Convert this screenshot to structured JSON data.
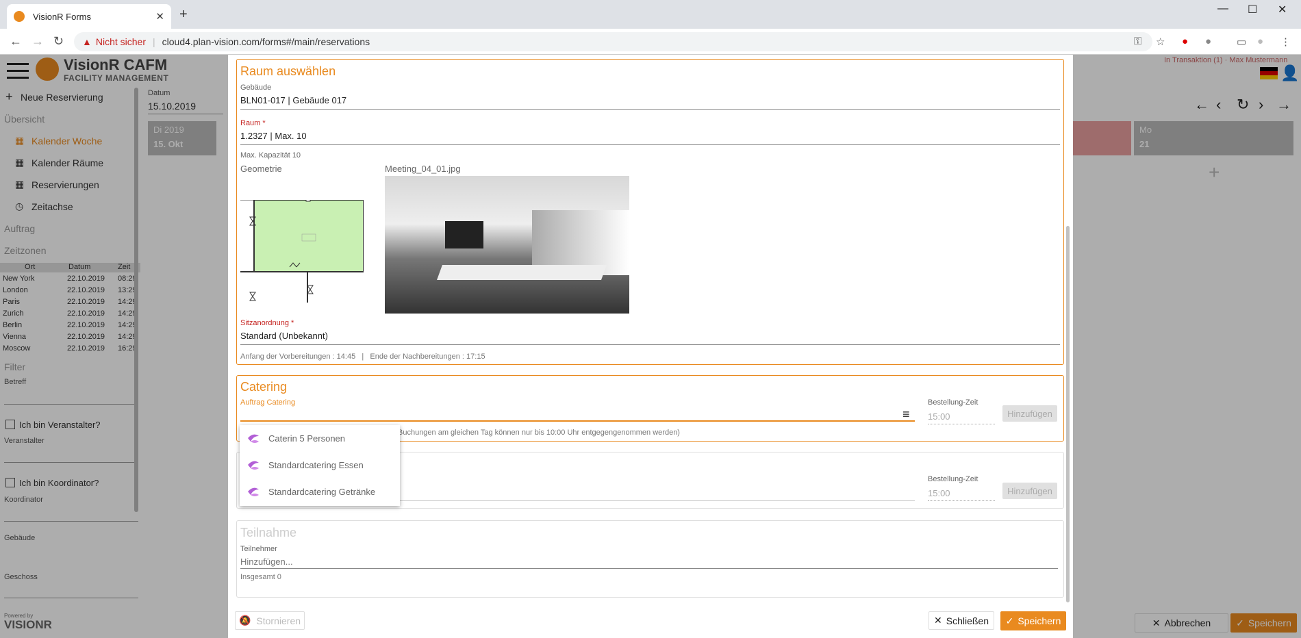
{
  "browser": {
    "tab_title": "VisionR Forms",
    "insecure_label": "Nicht sicher",
    "url": "cloud4.plan-vision.com/forms#/main/reservations"
  },
  "app": {
    "title": "VisionR CAFM",
    "subtitle": "FACILITY MANAGEMENT",
    "transaction": "In Transaktion (1) · Max Mustermann",
    "powered_by": "Powered by",
    "powered_brand": "VISIONR"
  },
  "sidebar": {
    "new_reservation": "Neue Reservierung",
    "overview": "Übersicht",
    "items": [
      {
        "label": "Kalender Woche"
      },
      {
        "label": "Kalender Räume"
      },
      {
        "label": "Reservierungen"
      },
      {
        "label": "Zeitachse"
      }
    ],
    "order": "Auftrag",
    "timezones": "Zeitzonen",
    "tz_headers": [
      "Ort",
      "Datum",
      "Zeit"
    ],
    "tz_rows": [
      [
        "New York",
        "22.10.2019",
        "08:29"
      ],
      [
        "London",
        "22.10.2019",
        "13:29"
      ],
      [
        "Paris",
        "22.10.2019",
        "14:29"
      ],
      [
        "Zurich",
        "22.10.2019",
        "14:29"
      ],
      [
        "Berlin",
        "22.10.2019",
        "14:29"
      ],
      [
        "Vienna",
        "22.10.2019",
        "14:29"
      ],
      [
        "Moscow",
        "22.10.2019",
        "16:29"
      ]
    ],
    "filter": "Filter",
    "betreff": "Betreff",
    "is_organizer": "Ich bin Veranstalter?",
    "organizer": "Veranstalter",
    "is_coordinator": "Ich bin Koordinator?",
    "coordinator": "Koordinator",
    "building": "Gebäude",
    "floor": "Geschoss"
  },
  "calendar": {
    "date_label": "Datum",
    "date_value": "15.10.2019",
    "day1_title": "Di 2019",
    "day1_sub": "15. Okt",
    "day_last_title": "Mo",
    "day_last_sub": "21",
    "cancel": "Abbrechen",
    "save": "Speichern"
  },
  "modal": {
    "room_section": {
      "title": "Raum auswählen",
      "building_label": "Gebäude",
      "building_value": "BLN01-017 | Gebäude 017",
      "room_label": "Raum",
      "room_value": "1.2327 | Max. 10",
      "capacity": "Max. Kapazität 10",
      "geometry_label": "Geometrie",
      "photo_label": "Meeting_04_01.jpg",
      "seating_label": "Sitzanordnung",
      "seating_value": "Standard (Unbekannt)",
      "prep_info": "Anfang der Vorbereitungen : 14:45   |   Ende der Nachbereitungen : 17:15"
    },
    "catering_section": {
      "title": "Catering",
      "order_label": "Auftrag Catering",
      "order_value": "",
      "time_label": "Bestellung-Zeit",
      "time_value": "15:00",
      "add": "Hinzufügen",
      "hint": "Buchungen am gleichen Tag können nur bis 10:00 Uhr entgegengenommen werden)"
    },
    "dropdown": [
      {
        "label": "Caterin 5 Personen"
      },
      {
        "label": "Standardcatering Essen"
      },
      {
        "label": "Standardcatering Getränke"
      }
    ],
    "second_section": {
      "time_label": "Bestellung-Zeit",
      "time_value": "15:00",
      "add": "Hinzufügen"
    },
    "participation": {
      "title": "Teilnahme",
      "participants_label": "Teilnehmer",
      "participants_placeholder": "Hinzufügen...",
      "total": "Insgesamt 0"
    },
    "footer": {
      "cancel_booking": "Stornieren",
      "close": "Schließen",
      "save": "Speichern"
    }
  },
  "colors": {
    "accent": "#e98a1f",
    "required": "#c5221f",
    "room_fill": "#c9f0b3"
  }
}
